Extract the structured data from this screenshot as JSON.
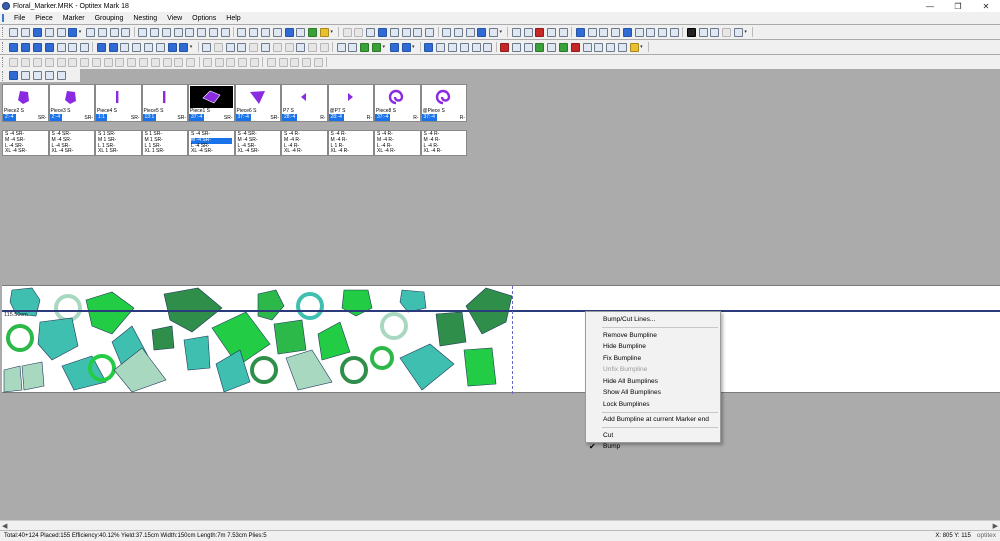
{
  "window": {
    "title": "Floral_Marker.MRK - Optitex Mark 18",
    "controls": {
      "minimize": "—",
      "restore": "❐",
      "close": "✕"
    }
  },
  "menu": [
    "File",
    "Piece",
    "Marker",
    "Grouping",
    "Nesting",
    "View",
    "Options",
    "Help"
  ],
  "pieces": [
    {
      "name": "Piece2 S",
      "count": "2:-4",
      "fold": "SR-",
      "color": "#8a2be2",
      "shape": "blob"
    },
    {
      "name": "Piece3 S",
      "count": "2:-4",
      "fold": "SR-",
      "color": "#8a2be2",
      "shape": "blob"
    },
    {
      "name": "Piece4 S",
      "count": "1:1",
      "fold": "SR-",
      "color": "#8a2be2",
      "shape": "bar"
    },
    {
      "name": "Piece5 S",
      "count": "13:1",
      "fold": "SR-",
      "color": "#8a2be2",
      "shape": "bar"
    },
    {
      "name": "Piece1 S",
      "count": "37:-4",
      "fold": "SR-",
      "color": "#8a2be2",
      "shape": "diamond",
      "selected": true
    },
    {
      "name": "Piece6 S",
      "count": "37:-4",
      "fold": "SR-",
      "color": "#8a2be2",
      "shape": "pent"
    },
    {
      "name": "P7 S",
      "count": "28:-4",
      "fold": "R-",
      "color": "#8a2be2",
      "shape": "tri"
    },
    {
      "name": "@P7 S",
      "count": "28:-4",
      "fold": "R-",
      "color": "#8a2be2",
      "shape": "tri2"
    },
    {
      "name": "Piece8 S",
      "count": "37:-4",
      "fold": "R-",
      "color": "#8a2be2",
      "shape": "spiral"
    },
    {
      "name": "@Piece S",
      "count": "37:-4",
      "fold": "R-",
      "color": "#8a2be2",
      "shape": "spiral"
    }
  ],
  "size_boxes": [
    {
      "rows": [
        "S  -4  SR-",
        "M  -4  SR-",
        "L  -4  SR-",
        "XL  -4  SR-"
      ]
    },
    {
      "rows": [
        "S  -4  SR-",
        "M  -4  SR-",
        "L  -4  SR-",
        "XL  -4  SR-"
      ]
    },
    {
      "rows": [
        "S  1  SR-",
        "M  1  SR-",
        "L  1  SR-",
        "XL  1  SR-"
      ]
    },
    {
      "rows": [
        "S  1  SR-",
        "M  1  SR-",
        "L  1  SR-",
        "XL  1  SR-"
      ]
    },
    {
      "rows": [
        "S  -4  SR-",
        "M  -4  SR-",
        "L  -4  SR-",
        "XL  -4  SR-"
      ],
      "highlight": 1
    },
    {
      "rows": [
        "S  -4  SR-",
        "M  -4  SR-",
        "L  -4  SR-",
        "XL  -4  SR-"
      ]
    },
    {
      "rows": [
        "S  -4  R-",
        "M  -4  R-",
        "L  -4  R-",
        "XL  -4  R-"
      ]
    },
    {
      "rows": [
        "S  -4  R-",
        "M  -4  R-",
        "L  1  R-",
        "XL  -4  R-"
      ]
    },
    {
      "rows": [
        "S  -4  R-",
        "M  -4  R-",
        "L  -4  R-",
        "XL  -4  R-"
      ]
    },
    {
      "rows": [
        "S  -4  R-",
        "M  -4  R-",
        "L  -4  R-",
        "XL  -4  R-"
      ]
    }
  ],
  "marker": {
    "length_label": "115.50cm",
    "colors": {
      "green": "#2db84a",
      "teal": "#3fbfb0",
      "dark_green": "#2f8f4a",
      "lime": "#22cc44",
      "mint": "#a8d8c0"
    }
  },
  "context_menu": {
    "items": [
      {
        "label": "Bump/Cut Lines...",
        "disabled": false
      },
      {
        "sep": true
      },
      {
        "label": "Remove Bumpline",
        "disabled": false
      },
      {
        "label": "Hide Bumpline",
        "disabled": false
      },
      {
        "label": "Fix Bumpline",
        "disabled": false
      },
      {
        "label": "Unfix Bumpline",
        "disabled": true
      },
      {
        "label": "Hide All Bumplines",
        "disabled": false
      },
      {
        "label": "Show All Bumplines",
        "disabled": false
      },
      {
        "label": "Lock Bumplines",
        "disabled": false
      },
      {
        "sep": true
      },
      {
        "label": "Add Bumpline at current Marker end",
        "disabled": false
      },
      {
        "sep": true
      },
      {
        "label": "Cut",
        "disabled": false
      },
      {
        "label": "Bump",
        "disabled": false,
        "checked": true
      }
    ]
  },
  "status": {
    "text": "Total:40+124  Placed:155  Efficiency:40.12%  Yield:37.15cm  Width:150cm  Length:7m 7.53cm  Plies:5",
    "coords": "X: 805  Y: 115",
    "brand": "optitex"
  },
  "scroll": {
    "left": "◀",
    "right": "▶"
  }
}
